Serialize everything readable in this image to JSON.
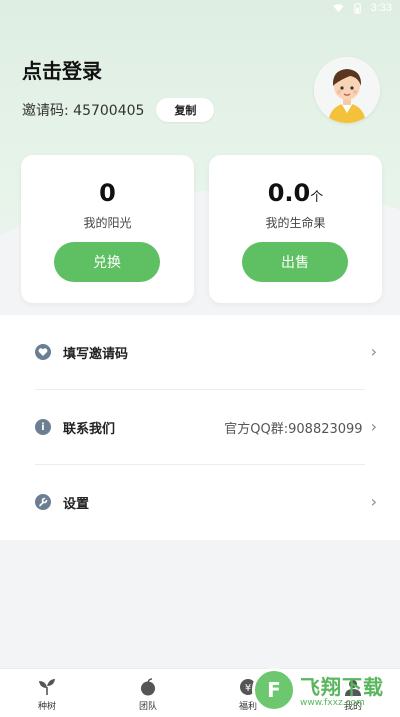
{
  "status_bar": {
    "time": "3:33"
  },
  "header": {
    "login_title": "点击登录",
    "invite_code_text": "邀请码: 45700405",
    "copy_label": "复制"
  },
  "cards": [
    {
      "value": "0",
      "unit": "",
      "label": "我的阳光",
      "button": "兑换"
    },
    {
      "value": "0.0",
      "unit": "个",
      "label": "我的生命果",
      "button": "出售"
    }
  ],
  "menu": [
    {
      "label": "填写邀请码",
      "value": "",
      "icon": "heart-icon"
    },
    {
      "label": "联系我们",
      "value": "官方QQ群:908823099",
      "icon": "info-icon"
    },
    {
      "label": "设置",
      "value": "",
      "icon": "wrench-icon"
    }
  ],
  "tabs": [
    {
      "label": "种树",
      "icon": "sprout-icon"
    },
    {
      "label": "团队",
      "icon": "apple-icon"
    },
    {
      "label": "福利",
      "icon": "coin-icon"
    },
    {
      "label": "我的",
      "icon": "user-icon"
    }
  ],
  "watermark": {
    "title": "飞翔下载",
    "sub": "www.fxxz.com",
    "logo": "F"
  },
  "colors": {
    "accent": "#5ec062",
    "hero_bg": "#e2f1e5",
    "page_bg": "#f3f4f6"
  }
}
